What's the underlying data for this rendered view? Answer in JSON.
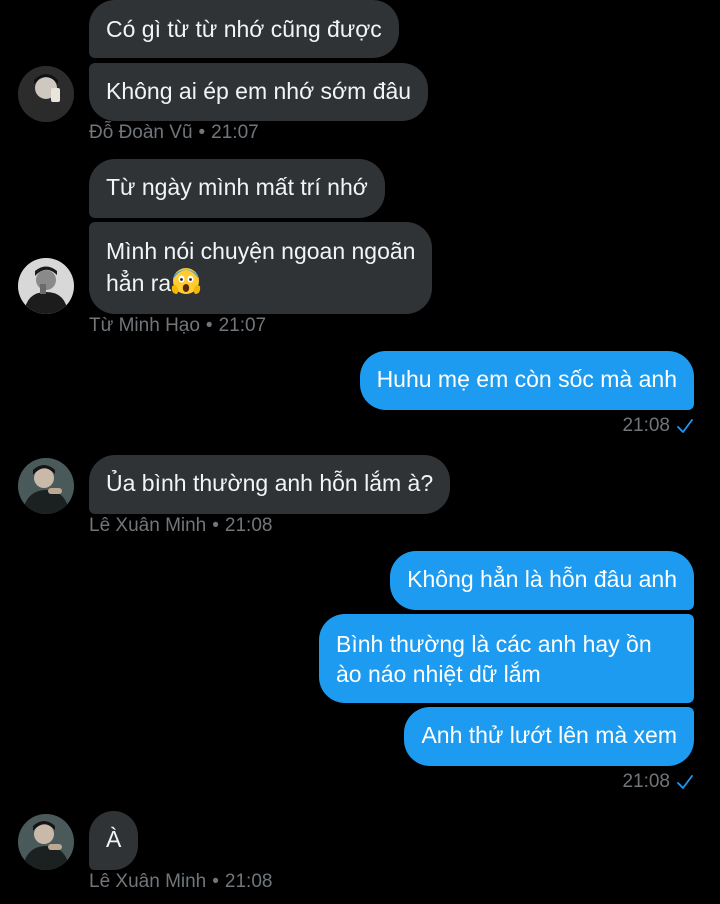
{
  "theme": {
    "background": "#000000",
    "incoming_bubble": "#2f3336",
    "outgoing_bubble": "#1d9bf0",
    "meta_text": "#71767b",
    "read_check": "#1d9bf0"
  },
  "messages": {
    "m1": {
      "text": "Có gì từ từ nhớ cũng được"
    },
    "m2": {
      "text": "Không ai ép em nhớ sớm đâu"
    },
    "meta1": {
      "sender": "Đỗ Đoàn Vũ",
      "time": "21:07"
    },
    "m3": {
      "text": "Từ ngày mình mất trí nhớ"
    },
    "m4": {
      "line1": "Mình nói chuyện ngoan ngoãn",
      "line2": "hẳn ra",
      "emoji": "screaming-face-emoji"
    },
    "meta2": {
      "sender": "Từ Minh Hạo",
      "time": "21:07"
    },
    "m5": {
      "text": "Huhu mẹ em còn sốc mà anh"
    },
    "t1": {
      "time": "21:08"
    },
    "m6": {
      "text": "Ủa bình thường anh hỗn lắm à?"
    },
    "meta3": {
      "sender": "Lê Xuân Minh",
      "time": "21:08"
    },
    "m7": {
      "text": "Không hẳn là hỗn đâu anh"
    },
    "m8": {
      "line1": "Bình thường là các anh hay ồn",
      "line2": "ào náo nhiệt dữ lắm"
    },
    "m9": {
      "text": "Anh thử lướt lên mà xem"
    },
    "t2": {
      "time": "21:08"
    },
    "m10": {
      "text": "À"
    },
    "meta4": {
      "sender": "Lê Xuân Minh",
      "time": "21:08"
    }
  },
  "separator": "•",
  "icons": {
    "read": "check-icon",
    "avatar": "avatar-photo"
  }
}
